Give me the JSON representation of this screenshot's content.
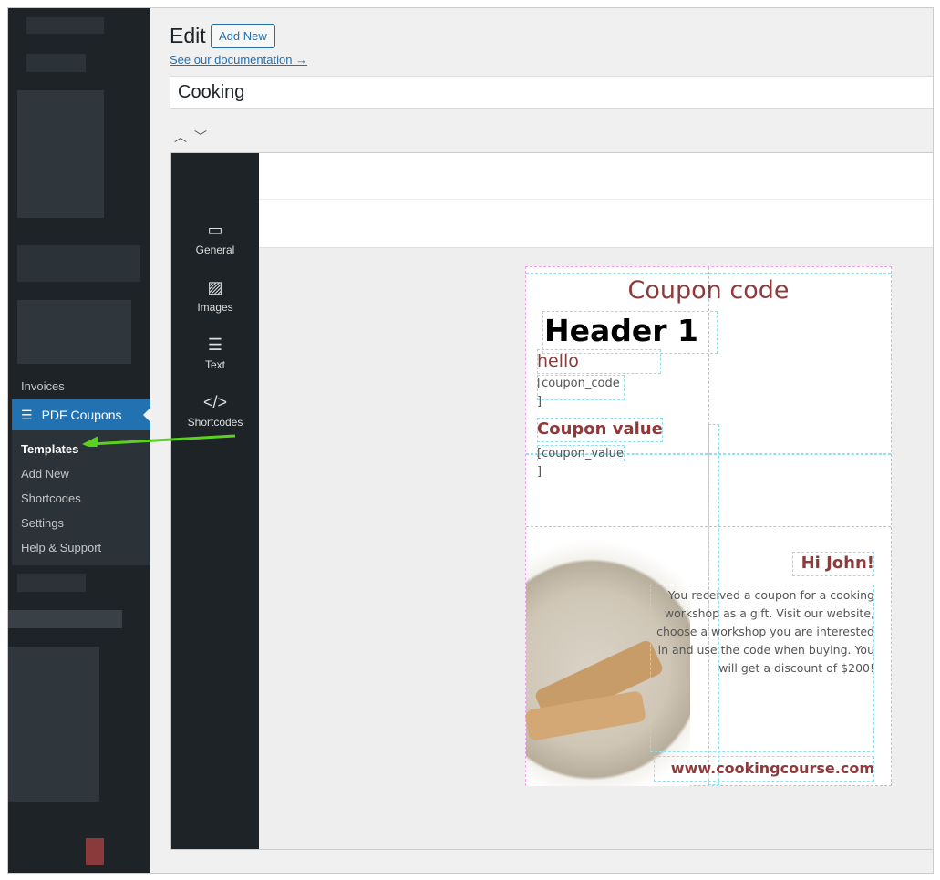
{
  "sidebar": {
    "invoices_label": "Invoices",
    "active_menu": "PDF Coupons",
    "submenu": [
      "Templates",
      "Add New",
      "Shortcodes",
      "Settings",
      "Help & Support"
    ]
  },
  "header": {
    "title": "Edit",
    "add_new": "Add New",
    "doc_link": "See our documentation →"
  },
  "post_title": "Cooking",
  "tools": [
    {
      "label": "General",
      "icon": "window-icon"
    },
    {
      "label": "Images",
      "icon": "images-icon"
    },
    {
      "label": "Text",
      "icon": "text-icon"
    },
    {
      "label": "Shortcodes",
      "icon": "code-icon"
    }
  ],
  "coupon": {
    "title": "Coupon code",
    "header1": "Header 1",
    "hello": "hello",
    "code_sc": "[coupon_code",
    "close1": "]",
    "value_title": "Coupon value",
    "value_sc": "[coupon_value",
    "close2": "]",
    "greeting": "Hi John!",
    "body": "You received a coupon for a cooking workshop as a gift. Visit our website, choose a workshop you are interested in and use the code when buying. You will get a discount of $200!",
    "website": "www.cookingcourse.com"
  },
  "colors": {
    "accent": "#2271b1",
    "coupon_red": "#8f3a3a",
    "arrow": "#5ad11c"
  }
}
